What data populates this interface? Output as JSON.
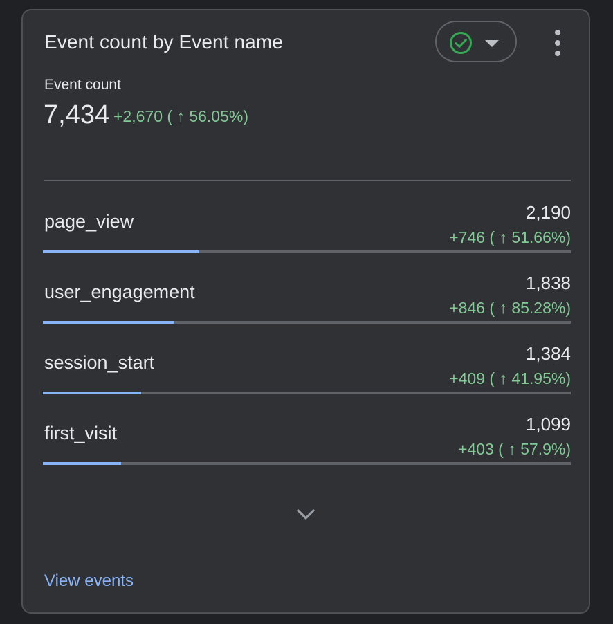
{
  "card": {
    "title": "Event count by Event name",
    "compare_icon": "check-circle-icon",
    "compare_caret_icon": "caret-down-icon",
    "menu_icon": "more-vert-icon"
  },
  "metric": {
    "label": "Event count",
    "total": "7,434",
    "delta": "+2,670 ( ↑ 56.05%)"
  },
  "rows": [
    {
      "name": "page_view",
      "value": "2,190",
      "delta": "+746 ( ↑ 51.66%)",
      "share": 0.2946
    },
    {
      "name": "user_engagement",
      "value": "1,838",
      "delta": "+846 ( ↑ 85.28%)",
      "share": 0.2472
    },
    {
      "name": "session_start",
      "value": "1,384",
      "delta": "+409 ( ↑ 41.95%)",
      "share": 0.1862
    },
    {
      "name": "first_visit",
      "value": "1,099",
      "delta": "+403 ( ↑ 57.9%)",
      "share": 0.1478
    }
  ],
  "expand_icon": "chevron-down-icon",
  "footer": {
    "link_label": "View events"
  },
  "colors": {
    "background": "#202124",
    "card": "#303134",
    "positive": "#81c995",
    "accent": "#8ab4f8",
    "check_green": "#34a853"
  }
}
